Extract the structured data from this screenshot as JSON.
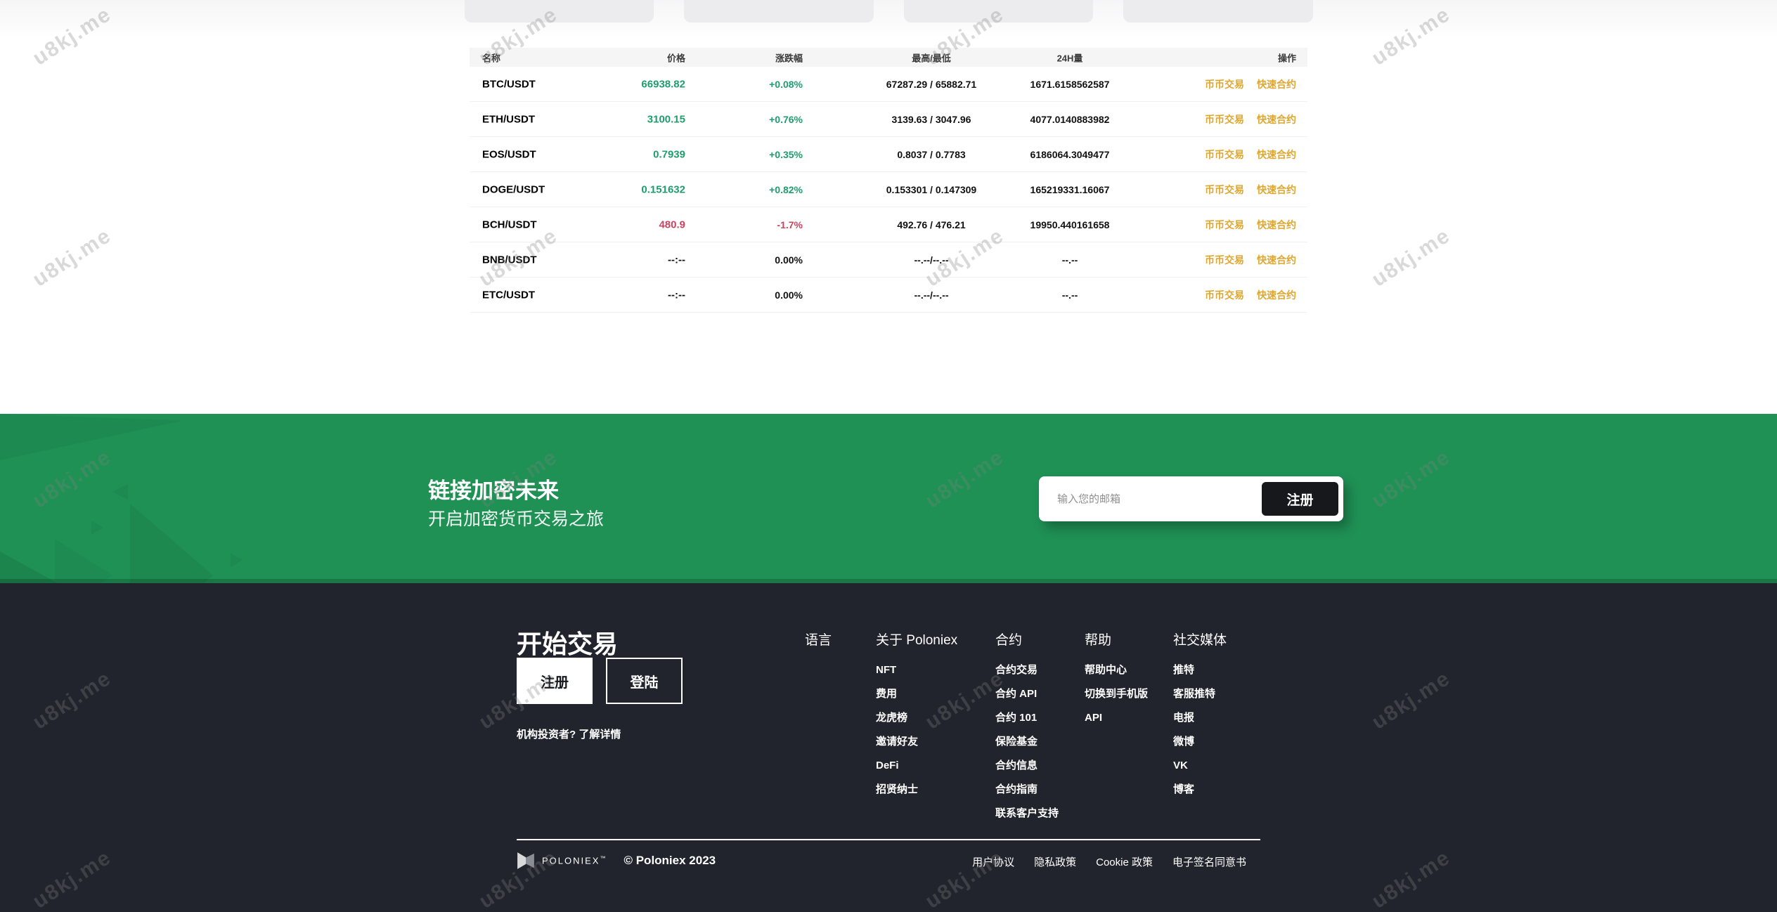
{
  "watermark": "u8kj.me",
  "colors": {
    "up_green": "#1e9d6e",
    "down_red": "#c9445f",
    "action_orange": "#dfa62e",
    "banner_green": "#1f9155",
    "footer_dark": "#21242c"
  },
  "market_table": {
    "headers": {
      "name": "名称",
      "price": "价格",
      "change": "涨跌幅",
      "high_low": "最高/最低",
      "volume": "24H量",
      "actions": "操作"
    },
    "action_labels": [
      "币币交易",
      "快速合约"
    ],
    "rows": [
      {
        "pair": "BTC/USDT",
        "price": "66938.82",
        "change": "+0.08%",
        "trend": "up",
        "high_low": "67287.29 / 65882.71",
        "volume": "1671.6158562587"
      },
      {
        "pair": "ETH/USDT",
        "price": "3100.15",
        "change": "+0.76%",
        "trend": "up",
        "high_low": "3139.63 / 3047.96",
        "volume": "4077.0140883982"
      },
      {
        "pair": "EOS/USDT",
        "price": "0.7939",
        "change": "+0.35%",
        "trend": "up",
        "high_low": "0.8037 / 0.7783",
        "volume": "6186064.3049477"
      },
      {
        "pair": "DOGE/USDT",
        "price": "0.151632",
        "change": "+0.82%",
        "trend": "up",
        "high_low": "0.153301 / 0.147309",
        "volume": "165219331.16067"
      },
      {
        "pair": "BCH/USDT",
        "price": "480.9",
        "change": "-1.7%",
        "trend": "down",
        "high_low": "492.76 / 476.21",
        "volume": "19950.440161658"
      },
      {
        "pair": "BNB/USDT",
        "price": "--:--",
        "change": "0.00%",
        "trend": "flat",
        "high_low": "--.--/--.--",
        "volume": "--.--"
      },
      {
        "pair": "ETC/USDT",
        "price": "--:--",
        "change": "0.00%",
        "trend": "flat",
        "high_low": "--.--/--.--",
        "volume": "--.--"
      }
    ]
  },
  "banner": {
    "title": "链接加密未来",
    "subtitle": "开启加密货币交易之旅",
    "email_placeholder": "输入您的邮箱",
    "signup_button": "注册"
  },
  "footer": {
    "cta_title": "开始交易",
    "register_button": "注册",
    "login_button": "登陆",
    "institutional_note": "机构投资者? 了解详情",
    "language_label": "语言",
    "columns": [
      {
        "title": "关于 Poloniex",
        "items": [
          "NFT",
          "费用",
          "龙虎榜",
          "邀请好友",
          "DeFi",
          "招贤纳士"
        ]
      },
      {
        "title": "合约",
        "items": [
          "合约交易",
          "合约 API",
          "合约 101",
          "保险基金",
          "合约信息",
          "合约指南",
          "联系客户支持"
        ]
      },
      {
        "title": "帮助",
        "items": [
          "帮助中心",
          "切换到手机版",
          "API"
        ]
      },
      {
        "title": "社交媒体",
        "items": [
          "推特",
          "客服推特",
          "电报",
          "微博",
          "VK",
          "博客"
        ]
      }
    ],
    "brand": {
      "logo_text": "POLONIEX",
      "trademark": "™",
      "copyright": "© Poloniex 2023"
    },
    "legal_links": [
      "用户协议",
      "隐私政策",
      "Cookie 政策",
      "电子签名同意书"
    ]
  }
}
